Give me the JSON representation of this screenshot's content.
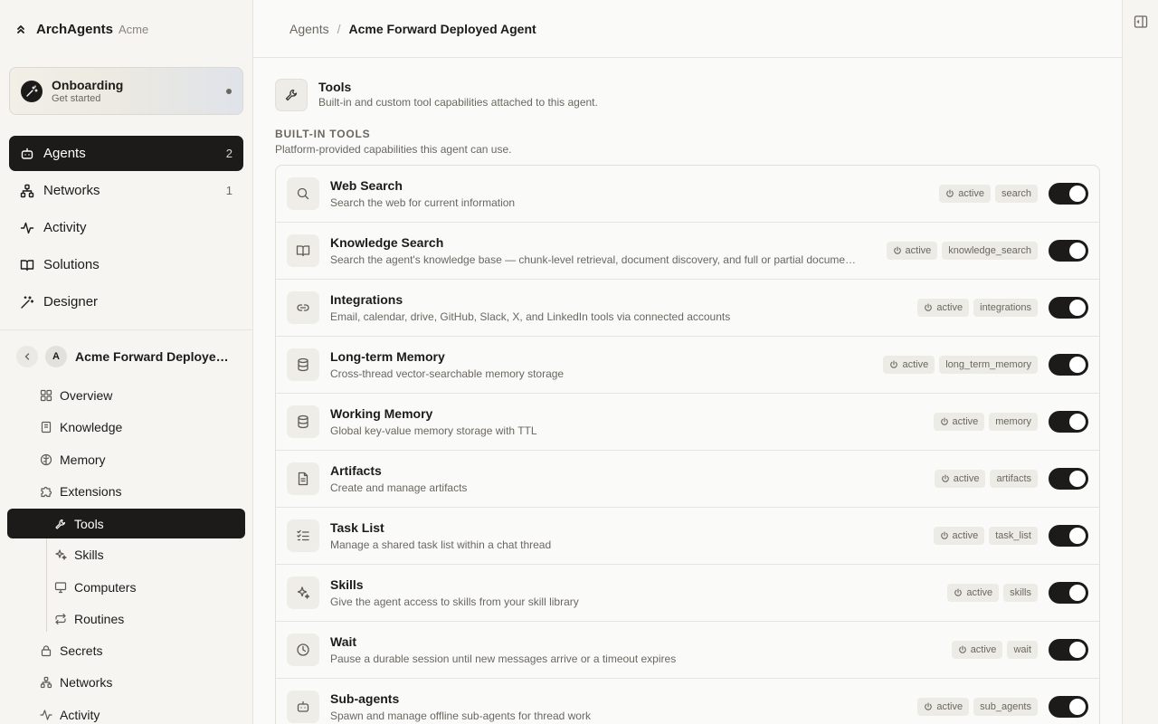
{
  "brand": {
    "name": "ArchAgents",
    "org": "Acme"
  },
  "onboarding": {
    "title": "Onboarding",
    "subtitle": "Get started"
  },
  "nav": [
    {
      "label": "Agents",
      "count": "2",
      "icon": "robot-icon",
      "active": true
    },
    {
      "label": "Networks",
      "count": "1",
      "icon": "network-icon"
    },
    {
      "label": "Activity",
      "count": "",
      "icon": "activity-icon"
    },
    {
      "label": "Solutions",
      "count": "",
      "icon": "book-icon"
    },
    {
      "label": "Designer",
      "count": "",
      "icon": "wand-icon"
    }
  ],
  "agent": {
    "avatar": "A",
    "name": "Acme Forward Deployed Agent"
  },
  "agent_nav": [
    {
      "label": "Overview",
      "icon": "grid-icon"
    },
    {
      "label": "Knowledge",
      "icon": "book-icon"
    },
    {
      "label": "Memory",
      "icon": "brain-icon"
    },
    {
      "label": "Extensions",
      "icon": "puzzle-icon"
    },
    {
      "label": "Tools",
      "icon": "wrench-icon",
      "active": true
    },
    {
      "label": "Skills",
      "icon": "sparkle-icon"
    },
    {
      "label": "Computers",
      "icon": "monitor-icon"
    },
    {
      "label": "Routines",
      "icon": "repeat-icon"
    },
    {
      "label": "Secrets",
      "icon": "lock-icon"
    },
    {
      "label": "Networks",
      "icon": "network-icon"
    },
    {
      "label": "Activity",
      "icon": "activity-icon"
    }
  ],
  "breadcrumb": {
    "parent": "Agents",
    "separator": "/",
    "current": "Acme Forward Deployed Agent"
  },
  "section": {
    "title": "Tools",
    "subtitle": "Built-in and custom tool capabilities attached to this agent."
  },
  "group": {
    "label": "BUILT-IN TOOLS",
    "subtitle": "Platform-provided capabilities this agent can use."
  },
  "tools": [
    {
      "name": "Web Search",
      "description": "Search the web for current information",
      "status": "active",
      "key": "search",
      "icon": "search-icon",
      "enabled": true
    },
    {
      "name": "Knowledge Search",
      "description": "Search the agent's knowledge base — chunk-level retrieval, document discovery, and full or partial document reads",
      "status": "active",
      "key": "knowledge_search",
      "icon": "book-open-icon",
      "enabled": true
    },
    {
      "name": "Integrations",
      "description": "Email, calendar, drive, GitHub, Slack, X, and LinkedIn tools via connected accounts",
      "status": "active",
      "key": "integrations",
      "icon": "link-icon",
      "enabled": true
    },
    {
      "name": "Long-term Memory",
      "description": "Cross-thread vector-searchable memory storage",
      "status": "active",
      "key": "long_term_memory",
      "icon": "database-icon",
      "enabled": true
    },
    {
      "name": "Working Memory",
      "description": "Global key-value memory storage with TTL",
      "status": "active",
      "key": "memory",
      "icon": "database-icon",
      "enabled": true
    },
    {
      "name": "Artifacts",
      "description": "Create and manage artifacts",
      "status": "active",
      "key": "artifacts",
      "icon": "file-icon",
      "enabled": true
    },
    {
      "name": "Task List",
      "description": "Manage a shared task list within a chat thread",
      "status": "active",
      "key": "task_list",
      "icon": "checklist-icon",
      "enabled": true
    },
    {
      "name": "Skills",
      "description": "Give the agent access to skills from your skill library",
      "status": "active",
      "key": "skills",
      "icon": "sparkle-icon",
      "enabled": true
    },
    {
      "name": "Wait",
      "description": "Pause a durable session until new messages arrive or a timeout expires",
      "status": "active",
      "key": "wait",
      "icon": "clock-icon",
      "enabled": true
    },
    {
      "name": "Sub-agents",
      "description": "Spawn and manage offline sub-agents for thread work",
      "status": "active",
      "key": "sub_agents",
      "icon": "robot-icon",
      "enabled": true
    }
  ]
}
